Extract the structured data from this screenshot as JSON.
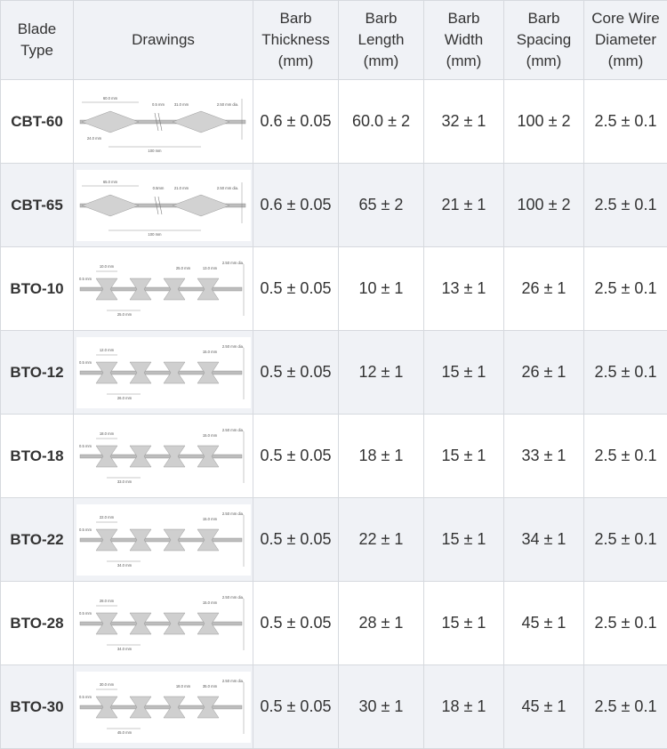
{
  "headers": [
    "Blade\nType",
    "Drawings",
    "Barb\nThickness\n(mm)",
    "Barb\nLength\n(mm)",
    "Barb\nWidth\n(mm)",
    "Barb\nSpacing\n(mm)",
    "Core Wire\nDiameter\n(mm)"
  ],
  "rows": [
    {
      "type": "CBT-60",
      "thickness": "0.6 ± 0.05",
      "length": "60.0 ± 2",
      "width": "32 ± 1",
      "spacing": "100 ± 2",
      "core": "2.5 ± 0.1",
      "drawing": {
        "style": "concertina",
        "labels": [
          "60.0 mm",
          "0.5 mm",
          "31.0 mm",
          "2.50 mm dia.",
          "24.0 mm",
          "100 mm"
        ]
      }
    },
    {
      "type": "CBT-65",
      "thickness": "0.6 ± 0.05",
      "length": "65 ± 2",
      "width": "21 ± 1",
      "spacing": "100 ± 2",
      "core": "2.5 ± 0.1",
      "drawing": {
        "style": "concertina",
        "labels": [
          "65.0 mm",
          "0.5mm",
          "21.0 mm",
          "2.50 mm dia.",
          "",
          "100 mm"
        ]
      }
    },
    {
      "type": "BTO-10",
      "thickness": "0.5 ± 0.05",
      "length": "10 ± 1",
      "width": "13 ± 1",
      "spacing": "26 ± 1",
      "core": "2.5 ± 0.1",
      "drawing": {
        "style": "bto",
        "labels": [
          "10.0 mm",
          "0.5 mm",
          "25.0 mm",
          "13.0 mm",
          "2.50 mm dia.",
          "25.0 mm"
        ]
      }
    },
    {
      "type": "BTO-12",
      "thickness": "0.5 ± 0.05",
      "length": "12 ± 1",
      "width": "15 ± 1",
      "spacing": "26 ± 1",
      "core": "2.5 ± 0.1",
      "drawing": {
        "style": "bto",
        "labels": [
          "12.0 mm",
          "0.5 mm",
          "",
          "15.0 mm",
          "2.50 mm dia.",
          "26.0 mm"
        ]
      }
    },
    {
      "type": "BTO-18",
      "thickness": "0.5 ± 0.05",
      "length": "18 ± 1",
      "width": "15 ± 1",
      "spacing": "33 ± 1",
      "core": "2.5 ± 0.1",
      "drawing": {
        "style": "bto",
        "labels": [
          "18.0 mm",
          "0.5 mm",
          "",
          "15.0 mm",
          "2.50 mm dia.",
          "33.0 mm"
        ]
      }
    },
    {
      "type": "BTO-22",
      "thickness": "0.5 ± 0.05",
      "length": "22 ± 1",
      "width": "15 ± 1",
      "spacing": "34 ± 1",
      "core": "2.5 ± 0.1",
      "drawing": {
        "style": "bto",
        "labels": [
          "22.0 mm",
          "0.5 mm",
          "",
          "15.0 mm",
          "2.50 mm dia.",
          "34.0 mm"
        ]
      }
    },
    {
      "type": "BTO-28",
      "thickness": "0.5 ± 0.05",
      "length": "28 ± 1",
      "width": "15 ± 1",
      "spacing": "45 ± 1",
      "core": "2.5 ± 0.1",
      "drawing": {
        "style": "bto",
        "labels": [
          "28.0 mm",
          "0.5 mm",
          "",
          "15.0 mm",
          "2.50 mm dia.",
          "34.0 mm"
        ]
      }
    },
    {
      "type": "BTO-30",
      "thickness": "0.5 ± 0.05",
      "length": "30 ± 1",
      "width": "18 ± 1",
      "spacing": "45 ± 1",
      "core": "2.5 ± 0.1",
      "drawing": {
        "style": "bto",
        "labels": [
          "30.0 mm",
          "0.5 mm",
          "18.0 mm",
          "35.0 mm",
          "2.50 mm dia.",
          "45.0 mm"
        ]
      }
    }
  ]
}
